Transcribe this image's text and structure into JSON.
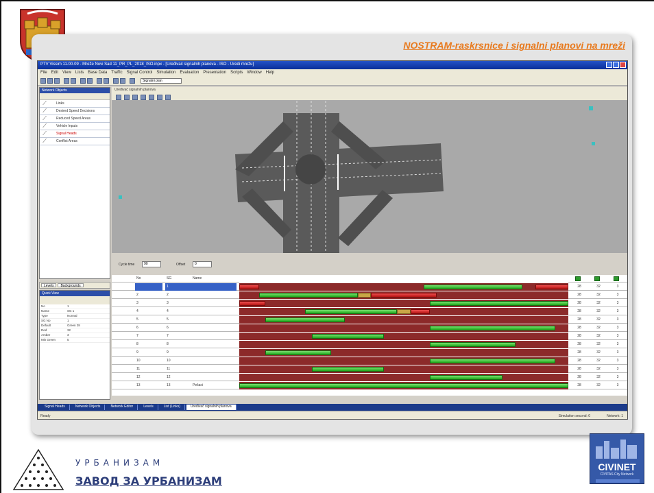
{
  "slide": {
    "title": "NOSTRAM-raskrsnice i signalni planovi na mreži"
  },
  "window": {
    "title": "PTV Vissim 11.00-09 - Mreže Novi Sad 11_PR_PL_2018_ISO.inpx - [Uređivač signalnih planova - ISO - Uredi mrežu]",
    "menu": [
      "File",
      "Edit",
      "View",
      "Lists",
      "Base Data",
      "Traffic",
      "Signal Control",
      "Simulation",
      "Evaluation",
      "Presentation",
      "Scripts",
      "Window",
      "Help"
    ],
    "toolbar_field": "Signalni plan",
    "view_title": "Uređivač signalnih planova"
  },
  "left_panel": {
    "header": "Network Objects",
    "items": [
      {
        "label": "Links",
        "icon": "link-icon"
      },
      {
        "label": "Desired Speed Decisions",
        "icon": "speed-icon"
      },
      {
        "label": "Reduced Speed Areas",
        "icon": "area-icon"
      },
      {
        "label": "Vehicle Inputs",
        "icon": "input-icon"
      },
      {
        "label": "Signal Heads",
        "icon": "signal-icon",
        "selected": true
      },
      {
        "label": "Conflict Areas",
        "icon": "conflict-icon"
      }
    ],
    "tabs": [
      "Levels",
      "Backgrounds"
    ]
  },
  "quick_view": {
    "header": "Quick View",
    "rows": [
      {
        "k": "No",
        "v": "1"
      },
      {
        "k": "Name",
        "v": "SG 1"
      },
      {
        "k": "Type",
        "v": "Normal"
      },
      {
        "k": "SG No",
        "v": "1"
      },
      {
        "k": "Default",
        "v": "Green 28"
      },
      {
        "k": "Red",
        "v": "32"
      },
      {
        "k": "Amber",
        "v": "3"
      },
      {
        "k": "Min Green",
        "v": "5"
      }
    ]
  },
  "sg_toolbar": {
    "label1": "Cycle time",
    "select1": "90",
    "label2": "Offset",
    "select2": "0"
  },
  "sg_table": {
    "headers": [
      "No",
      "SG",
      "Name"
    ],
    "num_headers": [
      "Green",
      "Amber",
      "Red"
    ],
    "rows": [
      {
        "no": "",
        "sg": "1",
        "name": "",
        "bars": [
          {
            "t": "red",
            "s": 0,
            "e": 6
          },
          {
            "t": "green",
            "s": 56,
            "e": 86
          },
          {
            "t": "red",
            "s": 90,
            "e": 100
          }
        ],
        "n": [
          "28",
          "32",
          "3"
        ]
      },
      {
        "no": "2",
        "sg": "2",
        "name": "",
        "bars": [
          {
            "t": "green",
            "s": 6,
            "e": 36
          },
          {
            "t": "amber",
            "s": 36,
            "e": 40
          },
          {
            "t": "red",
            "s": 40,
            "e": 60
          }
        ],
        "n": [
          "28",
          "32",
          "3"
        ]
      },
      {
        "no": "3",
        "sg": "3",
        "name": "",
        "bars": [
          {
            "t": "red",
            "s": 0,
            "e": 8
          },
          {
            "t": "green",
            "s": 58,
            "e": 100
          }
        ],
        "n": [
          "28",
          "32",
          "3"
        ]
      },
      {
        "no": "4",
        "sg": "4",
        "name": "",
        "bars": [
          {
            "t": "green",
            "s": 20,
            "e": 48
          },
          {
            "t": "amber",
            "s": 48,
            "e": 52
          },
          {
            "t": "red",
            "s": 52,
            "e": 58
          }
        ],
        "n": [
          "28",
          "32",
          "3"
        ]
      },
      {
        "no": "5",
        "sg": "5",
        "name": "",
        "bars": [
          {
            "t": "green",
            "s": 8,
            "e": 32
          }
        ],
        "n": [
          "28",
          "32",
          "3"
        ]
      },
      {
        "no": "6",
        "sg": "6",
        "name": "",
        "bars": [
          {
            "t": "green",
            "s": 58,
            "e": 96
          }
        ],
        "n": [
          "28",
          "32",
          "3"
        ]
      },
      {
        "no": "7",
        "sg": "7",
        "name": "",
        "bars": [
          {
            "t": "green",
            "s": 22,
            "e": 44
          }
        ],
        "n": [
          "28",
          "32",
          "3"
        ]
      },
      {
        "no": "8",
        "sg": "8",
        "name": "",
        "bars": [
          {
            "t": "green",
            "s": 58,
            "e": 84
          }
        ],
        "n": [
          "28",
          "32",
          "3"
        ]
      },
      {
        "no": "9",
        "sg": "9",
        "name": "",
        "bars": [
          {
            "t": "green",
            "s": 8,
            "e": 28
          }
        ],
        "n": [
          "28",
          "32",
          "3"
        ]
      },
      {
        "no": "10",
        "sg": "10",
        "name": "",
        "bars": [
          {
            "t": "green",
            "s": 58,
            "e": 96
          }
        ],
        "n": [
          "28",
          "32",
          "3"
        ]
      },
      {
        "no": "11",
        "sg": "11",
        "name": "",
        "bars": [
          {
            "t": "green",
            "s": 22,
            "e": 44
          }
        ],
        "n": [
          "28",
          "32",
          "3"
        ]
      },
      {
        "no": "12",
        "sg": "12",
        "name": "",
        "bars": [
          {
            "t": "green",
            "s": 58,
            "e": 80
          }
        ],
        "n": [
          "28",
          "32",
          "3"
        ]
      },
      {
        "no": "13",
        "sg": "13",
        "name": "Pešaci",
        "bars": [
          {
            "t": "green",
            "s": 0,
            "e": 100
          }
        ],
        "n": [
          "28",
          "32",
          "3"
        ]
      }
    ]
  },
  "bottom_tabs": [
    "Signal Heads",
    "Network Objects",
    "Network Editor",
    "Levels",
    "List (Links)",
    "Uređivač signalnih planova"
  ],
  "status": {
    "left": "Ready",
    "right1": "Simulation second: 0",
    "right2": "Network: 1"
  },
  "logos": {
    "institute_line1": "УРБАНИЗАМ",
    "institute_line2": "ЗАВОД ЗА УРБАНИЗАМ",
    "civinet": "CIVINET",
    "civinet_sub": "CIVITAS City Network"
  }
}
